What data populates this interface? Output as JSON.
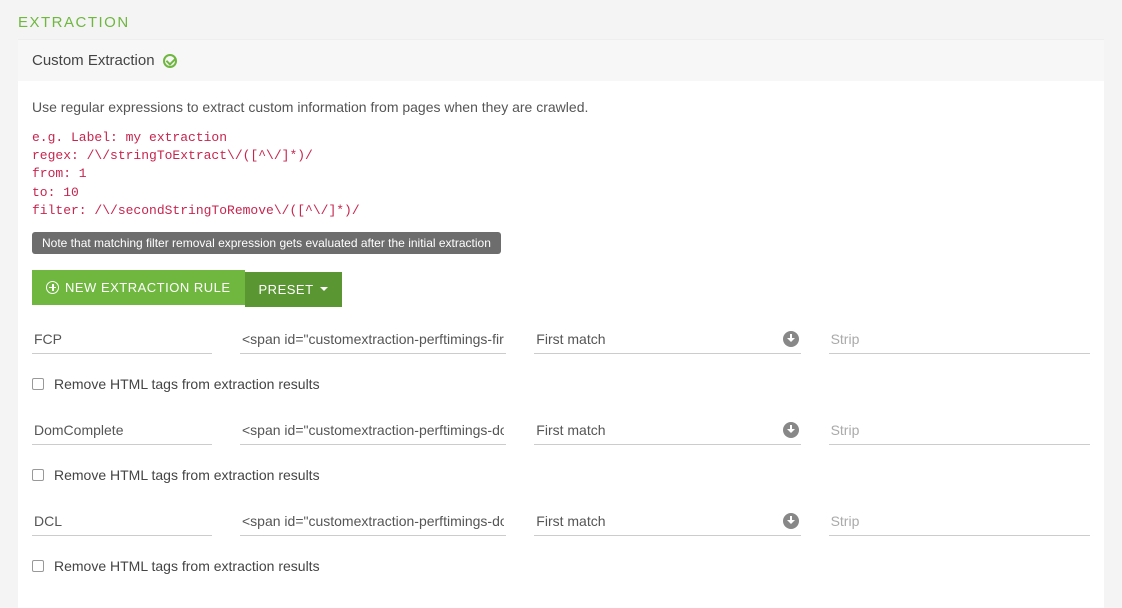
{
  "header": {
    "title": "EXTRACTION"
  },
  "section": {
    "title": "Custom Extraction",
    "description": "Use regular expressions to extract custom information from pages when they are crawled.",
    "example": "e.g. Label: my extraction\nregex: /\\/stringToExtract\\/([^\\/]*)/\nfrom: 1\nto: 10\nfilter: /\\/secondStringToRemove\\/([^\\/]*)/",
    "note": "Note that matching filter removal expression gets evaluated after the initial extraction"
  },
  "buttons": {
    "new_rule": "NEW EXTRACTION RULE",
    "preset": "PRESET"
  },
  "placeholders": {
    "strip": "Strip"
  },
  "rules": [
    {
      "name": "FCP",
      "regex": "<span id=\"customextraction-perftimings-first-",
      "match": "First match",
      "strip": "",
      "remove_label": "Remove HTML tags from extraction results",
      "remove_checked": false
    },
    {
      "name": "DomComplete",
      "regex": "<span id=\"customextraction-perftimings-dom",
      "match": "First match",
      "strip": "",
      "remove_label": "Remove HTML tags from extraction results",
      "remove_checked": false
    },
    {
      "name": "DCL",
      "regex": "<span id=\"customextraction-perftimings-dom",
      "match": "First match",
      "strip": "",
      "remove_label": "Remove HTML tags from extraction results",
      "remove_checked": false
    }
  ]
}
